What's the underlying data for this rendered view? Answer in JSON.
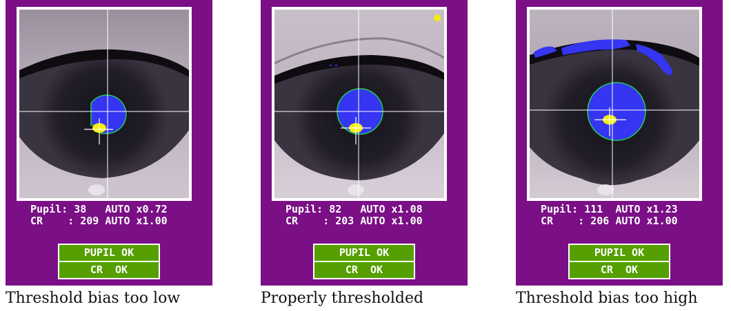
{
  "panels": [
    {
      "pupil_label": "Pupil:",
      "pupil_value": "38",
      "pupil_mode": "AUTO",
      "pupil_gain": "x0.72",
      "cr_label": "CR",
      "cr_value": ": 209",
      "cr_mode": "AUTO",
      "cr_gain": "x1.00",
      "status_pupil": "PUPIL OK",
      "status_cr": "CR  OK",
      "caption": "Threshold bias too low"
    },
    {
      "pupil_label": "Pupil:",
      "pupil_value": "82",
      "pupil_mode": "AUTO",
      "pupil_gain": "x1.08",
      "cr_label": "CR",
      "cr_value": ": 203",
      "cr_mode": "AUTO",
      "cr_gain": "x1.00",
      "status_pupil": "PUPIL OK",
      "status_cr": "CR  OK",
      "caption": "Properly thresholded"
    },
    {
      "pupil_label": "Pupil:",
      "pupil_value": "111",
      "pupil_mode": "AUTO",
      "pupil_gain": "x1.23",
      "cr_label": "CR",
      "cr_value": ": 206",
      "cr_mode": "AUTO",
      "cr_gain": "x1.00",
      "status_pupil": "PUPIL OK",
      "status_cr": "CR  OK",
      "caption": "Threshold bias too high"
    }
  ],
  "colors": {
    "panel_bg": "#7b0f86",
    "status_bg": "#55a000",
    "pupil_fill": "#3535f2",
    "pupil_outline": "#22cc55",
    "corneal_reflection": "#f5f000",
    "crosshair": "#ffffff"
  },
  "icons": [
    "eye-camera-image",
    "crosshair-icon",
    "pupil-marker-icon"
  ]
}
